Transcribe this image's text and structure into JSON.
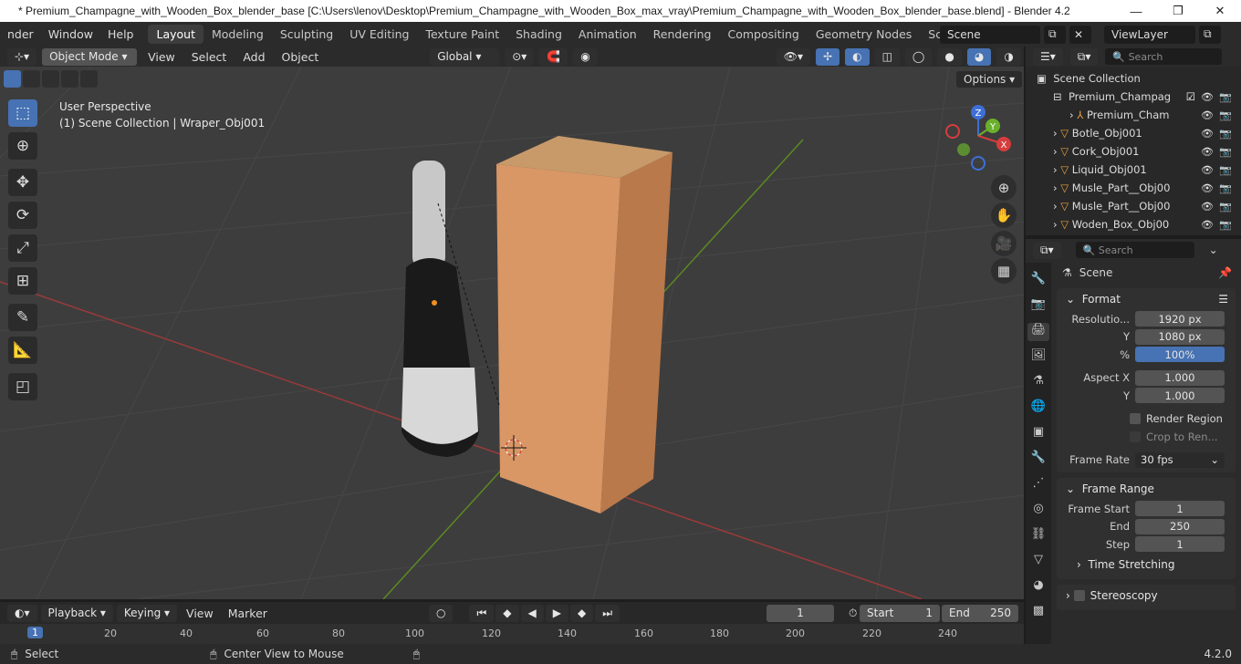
{
  "window": {
    "title": "* Premium_Champagne_with_Wooden_Box_blender_base [C:\\Users\\lenov\\Desktop\\Premium_Champagne_with_Wooden_Box_max_vray\\Premium_Champagne_with_Wooden_Box_blender_base.blend] - Blender 4.2",
    "min": "—",
    "max": "❐",
    "close": "✕"
  },
  "menu": [
    "nder",
    "Window",
    "Help"
  ],
  "workspaces": [
    "Layout",
    "Modeling",
    "Sculpting",
    "UV Editing",
    "Texture Paint",
    "Shading",
    "Animation",
    "Rendering",
    "Compositing",
    "Geometry Nodes",
    "Scripting"
  ],
  "topright": {
    "scene": "Scene",
    "viewlayer": "ViewLayer"
  },
  "viewport_header": {
    "mode": "Object Mode",
    "menus": [
      "View",
      "Select",
      "Add",
      "Object"
    ],
    "orientation": "Global",
    "options": "Options"
  },
  "viewport": {
    "perspective": "User Perspective",
    "collection": "(1) Scene Collection | Wraper_Obj001"
  },
  "gizmo": {
    "x": "X",
    "y": "Y",
    "z": "Z"
  },
  "outliner": {
    "search_placeholder": "Search",
    "root": "Scene Collection",
    "items": [
      {
        "label": "Premium_Champag",
        "indent": 1
      },
      {
        "label": "Premium_Cham",
        "indent": 2
      },
      {
        "label": "Botle_Obj001",
        "indent": 1
      },
      {
        "label": "Cork_Obj001",
        "indent": 1
      },
      {
        "label": "Liquid_Obj001",
        "indent": 1
      },
      {
        "label": "Musle_Part__Obj00",
        "indent": 1
      },
      {
        "label": "Musle_Part__Obj00",
        "indent": 1
      },
      {
        "label": "Woden_Box_Obj00",
        "indent": 1
      }
    ]
  },
  "properties": {
    "search_placeholder": "Search",
    "context": "Scene",
    "format": {
      "title": "Format",
      "res_x_label": "Resolutio...",
      "res_x": "1920 px",
      "res_y_label": "Y",
      "res_y": "1080 px",
      "pct_label": "%",
      "pct": "100%",
      "aspect_x_label": "Aspect X",
      "aspect_x": "1.000",
      "aspect_y_label": "Y",
      "aspect_y": "1.000",
      "render_region": "Render Region",
      "crop": "Crop to Ren...",
      "fps_label": "Frame Rate",
      "fps": "30 fps"
    },
    "frame_range": {
      "title": "Frame Range",
      "start_label": "Frame Start",
      "start": "1",
      "end_label": "End",
      "end": "250",
      "step_label": "Step",
      "step": "1",
      "time_stretching": "Time Stretching"
    },
    "stereoscopy": "Stereoscopy"
  },
  "timeline": {
    "menus": [
      "Playback",
      "Keying",
      "View",
      "Marker"
    ],
    "current": "1",
    "start_label": "Start",
    "start": "1",
    "end_label": "End",
    "end": "250",
    "ticks": [
      "1",
      "20",
      "40",
      "60",
      "80",
      "100",
      "120",
      "140",
      "160",
      "180",
      "200",
      "220",
      "240"
    ]
  },
  "status": {
    "select": "Select",
    "center": "Center View to Mouse",
    "version": "4.2.0"
  }
}
